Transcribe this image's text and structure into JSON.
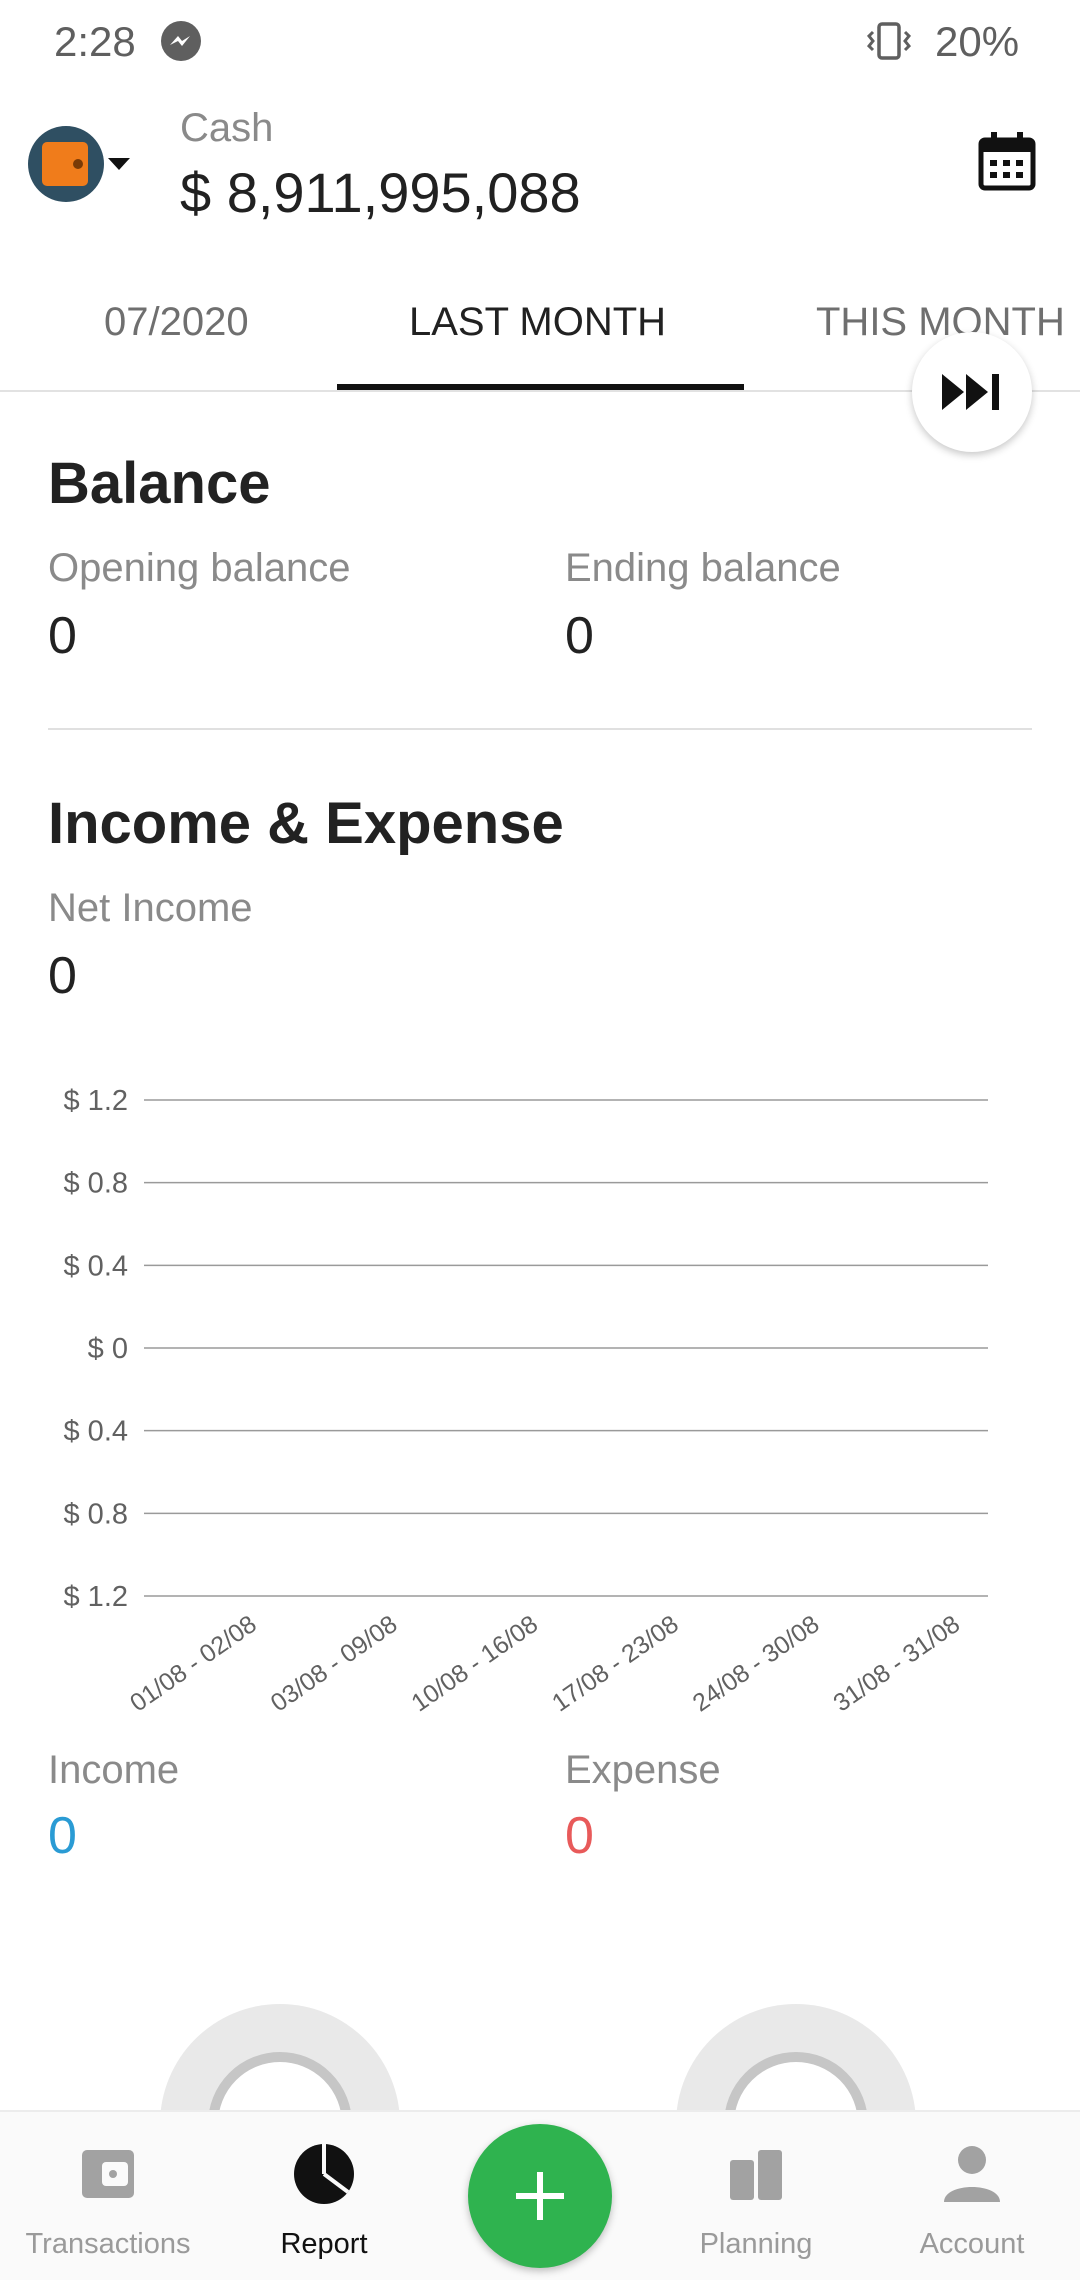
{
  "status_bar": {
    "time": "2:28",
    "battery": "20%"
  },
  "header": {
    "account_name": "Cash",
    "balance": "$ 8,911,995,088"
  },
  "tabs": [
    {
      "label": "07/2020",
      "selected": false
    },
    {
      "label": "LAST MONTH",
      "selected": true
    },
    {
      "label": "THIS MONTH",
      "selected": false
    }
  ],
  "balance": {
    "title": "Balance",
    "opening_label": "Opening balance",
    "opening_value": "0",
    "ending_label": "Ending balance",
    "ending_value": "0"
  },
  "income_expense": {
    "title": "Income & Expense",
    "net_label": "Net Income",
    "net_value": "0",
    "income_label": "Income",
    "income_value": "0",
    "expense_label": "Expense",
    "expense_value": "0"
  },
  "chart_data": {
    "type": "bar",
    "categories": [
      "01/08 - 02/08",
      "03/08 - 09/08",
      "10/08 - 16/08",
      "17/08 - 23/08",
      "24/08 - 30/08",
      "31/08 - 31/08"
    ],
    "series": [
      {
        "values": [
          0,
          0,
          0,
          0,
          0,
          0
        ]
      }
    ],
    "y_ticks": [
      "$ 1.2",
      "$ 0.8",
      "$ 0.4",
      "$ 0",
      "$ 0.4",
      "$ 0.8",
      "$ 1.2"
    ],
    "ylim": [
      -1.2,
      1.2
    ],
    "grid": true
  },
  "colors": {
    "income": "#2a9bd4",
    "expense": "#e85a5a",
    "fab": "#2fb34f"
  },
  "nav": [
    {
      "label": "Transactions",
      "icon": "wallet-icon",
      "active": false
    },
    {
      "label": "Report",
      "icon": "pie-chart-icon",
      "active": true
    },
    {
      "label": "Planning",
      "icon": "planning-icon",
      "active": false
    },
    {
      "label": "Account",
      "icon": "person-icon",
      "active": false
    }
  ],
  "fab_icon": "plus-icon"
}
